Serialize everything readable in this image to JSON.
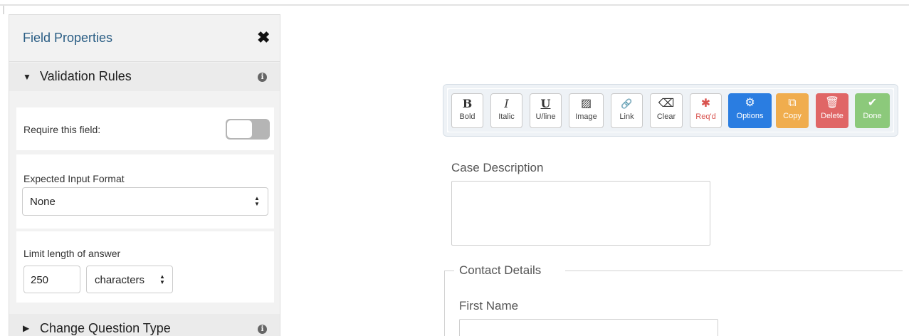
{
  "panel": {
    "title": "Field Properties",
    "close_glyph": "✖",
    "validation_section": {
      "label": "Validation Rules",
      "caret": "▼",
      "info": "i"
    },
    "require": {
      "label": "Require this field:",
      "toggle_on": false
    },
    "format": {
      "label": "Expected Input Format",
      "selected": "None",
      "arrows_up": "▲",
      "arrows_down": "▼"
    },
    "limit": {
      "label": "Limit length of answer",
      "value": "250",
      "unit": "characters",
      "arrows_up": "▲",
      "arrows_down": "▼"
    },
    "change_section": {
      "label": "Change Question Type",
      "caret": "▶",
      "info": "i"
    }
  },
  "toolbar": {
    "buttons": [
      {
        "label": "Bold",
        "icon": "B",
        "icon_name": "bold-icon"
      },
      {
        "label": "Italic",
        "icon": "I",
        "icon_name": "italic-icon"
      },
      {
        "label": "U/line",
        "icon": "U",
        "icon_name": "underline-icon"
      },
      {
        "label": "Image",
        "icon": "▨",
        "icon_name": "image-icon"
      },
      {
        "label": "Link",
        "icon": "🔗",
        "icon_name": "link-icon"
      },
      {
        "label": "Clear",
        "icon": "⌫",
        "icon_name": "eraser-icon"
      },
      {
        "label": "Req'd",
        "icon": "✱",
        "icon_name": "asterisk-icon"
      },
      {
        "label": "Options",
        "icon": "⚙",
        "icon_name": "gear-icon",
        "color": "#2a7de1"
      },
      {
        "label": "Copy",
        "icon": "⧉",
        "icon_name": "copy-icon",
        "color": "#f0ad4e"
      },
      {
        "label": "Delete",
        "icon": "🗑",
        "icon_name": "trash-icon",
        "color": "#e06666"
      },
      {
        "label": "Done",
        "icon": "✔",
        "icon_name": "check-icon",
        "color": "#8cc97b"
      }
    ]
  },
  "form": {
    "case_description_label": "Case Description",
    "contact_details_legend": "Contact Details",
    "first_name_label": "First Name"
  },
  "colors": {
    "panel_title": "#2a5d84",
    "options_blue": "#2a7de1",
    "copy_orange": "#f0ad4e",
    "delete_red": "#e06666",
    "done_green": "#8cc97b",
    "required_red": "#d9534f"
  }
}
